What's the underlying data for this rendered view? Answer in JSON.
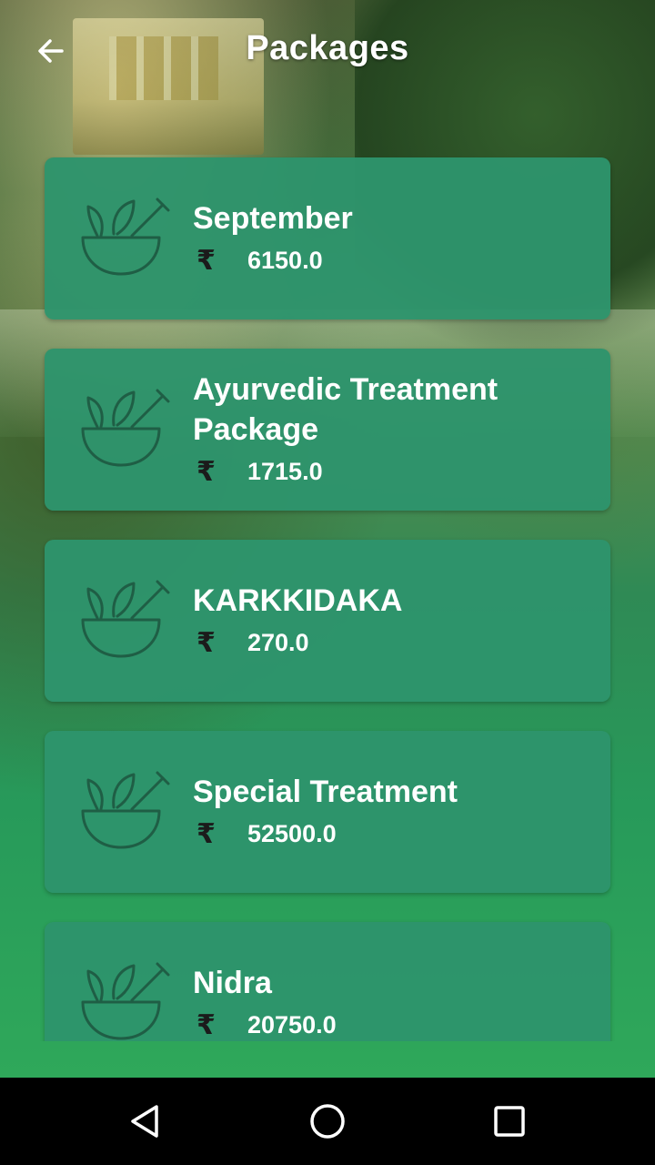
{
  "appbar": {
    "title": "Packages",
    "back_icon": "arrow-left-icon"
  },
  "packages": [
    {
      "name": "September",
      "currency": "₹",
      "price": "6150.0",
      "icon": "mortar-pestle-herb-icon"
    },
    {
      "name": "Ayurvedic Treatment Package",
      "currency": "₹",
      "price": "1715.0",
      "icon": "mortar-pestle-herb-icon"
    },
    {
      "name": "KARKKIDAKA",
      "currency": "₹",
      "price": "270.0",
      "icon": "mortar-pestle-herb-icon"
    },
    {
      "name": "Special Treatment",
      "currency": "₹",
      "price": "52500.0",
      "icon": "mortar-pestle-herb-icon"
    },
    {
      "name": "Nidra",
      "currency": "₹",
      "price": "20750.0",
      "icon": "mortar-pestle-herb-icon"
    }
  ],
  "navbar": {
    "back": "triangle-back-icon",
    "home": "circle-home-icon",
    "recents": "square-recents-icon"
  },
  "colors": {
    "card": "#2e946c",
    "accent": "#2fa85a",
    "text": "#ffffff"
  }
}
